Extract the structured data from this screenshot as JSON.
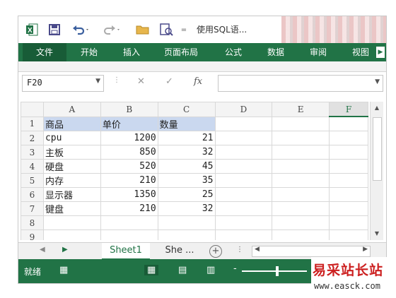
{
  "titlebar": {
    "title": "使用SQL语...",
    "icons": [
      "excel-logo",
      "save",
      "undo",
      "redo",
      "open-folder",
      "print-preview",
      "customize"
    ]
  },
  "ribbon": {
    "tabs": [
      "文件",
      "开始",
      "插入",
      "页面布局",
      "公式",
      "数据",
      "审阅",
      "视图"
    ]
  },
  "formula_bar": {
    "name_box": "F20",
    "cancel_icon": "✕",
    "enter_icon": "✓",
    "fx_label": "fx",
    "formula": ""
  },
  "sheet": {
    "columns": [
      "A",
      "B",
      "C",
      "D",
      "E",
      "F"
    ],
    "selected_column": "F",
    "row_numbers": [
      "1",
      "2",
      "3",
      "4",
      "5",
      "6",
      "7",
      "8",
      "9"
    ],
    "rows": [
      [
        "商品",
        "单价",
        "数量"
      ],
      [
        "cpu",
        "1200",
        "21"
      ],
      [
        "主板",
        "850",
        "32"
      ],
      [
        "硬盘",
        "520",
        "45"
      ],
      [
        "内存",
        "210",
        "35"
      ],
      [
        "显示器",
        "1350",
        "25"
      ],
      [
        "键盘",
        "210",
        "32"
      ]
    ],
    "header_fill": "#cad8ef"
  },
  "sheet_tabs": {
    "active": "Sheet1",
    "other": "She ...",
    "add_label": "+"
  },
  "status": {
    "ready": "就绪",
    "accent": "#217346"
  },
  "watermark": {
    "brand": "易采站长站",
    "url": "www.easck.com"
  }
}
